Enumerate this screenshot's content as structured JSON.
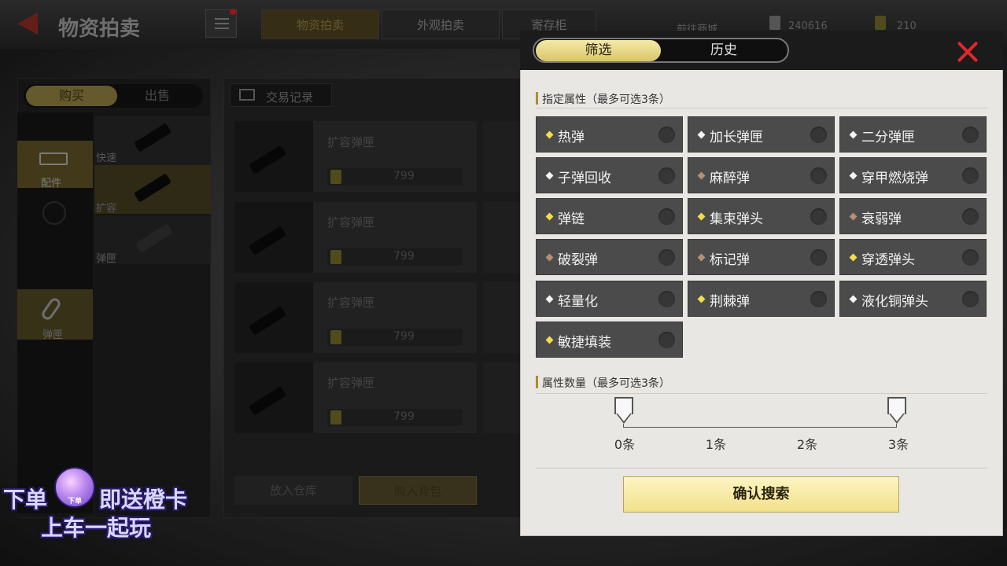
{
  "background": {
    "page_title": "物资拍卖",
    "top_tabs": [
      "物资拍卖",
      "外观拍卖",
      "寄存柜"
    ],
    "top_link": "前往商城",
    "currency": [
      "240616",
      "210"
    ],
    "buy_tab": "购买",
    "sell_tab": "出售",
    "selected_category": "配件",
    "ammo_category": "弹匣",
    "sub_items": [
      "快速",
      "扩容",
      "弹匣"
    ],
    "trade_record": "交易记录",
    "listing_name": "扩容弹匣",
    "listing_price": "799",
    "put_back_label": "放入仓库",
    "buy_bag_label": "购入背包"
  },
  "overlay": {
    "line1_left": "下单",
    "badge": "下单",
    "line1_right": "即送橙卡",
    "line2": "上车一起玩"
  },
  "modal": {
    "tabs": {
      "filter": "筛选",
      "history": "历史"
    },
    "section1_title": "指定属性（最多可选3条）",
    "options": [
      {
        "label": "热弹",
        "tier": "gold"
      },
      {
        "label": "加长弹匣",
        "tier": "white"
      },
      {
        "label": "二分弹匣",
        "tier": "white"
      },
      {
        "label": "子弹回收",
        "tier": "white"
      },
      {
        "label": "麻醉弹",
        "tier": "brown"
      },
      {
        "label": "穿甲燃烧弹",
        "tier": "white"
      },
      {
        "label": "弹链",
        "tier": "gold"
      },
      {
        "label": "集束弹头",
        "tier": "gold"
      },
      {
        "label": "衰弱弹",
        "tier": "brown"
      },
      {
        "label": "破裂弹",
        "tier": "brown"
      },
      {
        "label": "标记弹",
        "tier": "brown"
      },
      {
        "label": "穿透弹头",
        "tier": "gold"
      },
      {
        "label": "轻量化",
        "tier": "white"
      },
      {
        "label": "荆棘弹",
        "tier": "gold"
      },
      {
        "label": "液化铜弹头",
        "tier": "white"
      },
      {
        "label": "敏捷填装",
        "tier": "gold"
      }
    ],
    "section2_title": "属性数量（最多可选3条）",
    "slider_ticks": [
      "0条",
      "1条",
      "2条",
      "3条"
    ],
    "slider_range": [
      0,
      3
    ],
    "confirm_label": "确认搜索"
  },
  "colors": {
    "accent_gold": "#f2dc4c",
    "close_red": "#e0282a",
    "option_bg": "#4b4b4b",
    "confirm_bg": "#f2e08a"
  }
}
